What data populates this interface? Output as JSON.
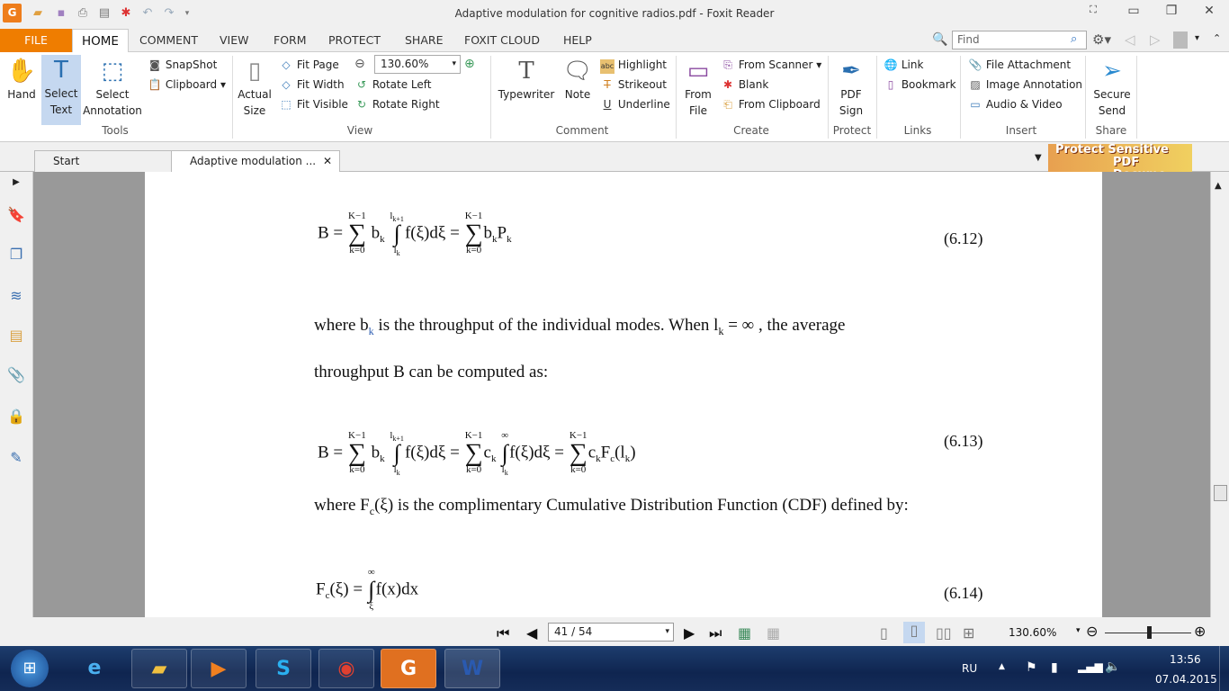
{
  "window": {
    "title": "Adaptive modulation for cognitive radios.pdf - Foxit Reader"
  },
  "quick_access": [
    "open-icon",
    "save-icon",
    "print-icon",
    "properties-icon",
    "new-icon",
    "undo-icon",
    "redo-icon",
    "customize-icon"
  ],
  "menu": {
    "file": "FILE",
    "tabs": [
      "HOME",
      "COMMENT",
      "VIEW",
      "FORM",
      "PROTECT",
      "SHARE",
      "FOXIT CLOUD",
      "HELP"
    ]
  },
  "search": {
    "placeholder": "Find"
  },
  "ribbon": {
    "tools": {
      "hand": "Hand",
      "select_text": "Select\nText",
      "select_annotation": "Select\nAnnotation",
      "snapshot": "SnapShot",
      "clipboard": "Clipboard",
      "group": "Tools"
    },
    "view": {
      "actual_size": "Actual\nSize",
      "fit_page": "Fit Page",
      "fit_width": "Fit Width",
      "fit_visible": "Fit Visible",
      "zoom": "130.60%",
      "rotate_left": "Rotate Left",
      "rotate_right": "Rotate Right",
      "group": "View"
    },
    "comment": {
      "typewriter": "Typewriter",
      "note": "Note",
      "highlight": "Highlight",
      "strikeout": "Strikeout",
      "underline": "Underline",
      "group": "Comment"
    },
    "create": {
      "from_file": "From\nFile",
      "from_scanner": "From Scanner",
      "blank": "Blank",
      "from_clipboard": "From Clipboard",
      "group": "Create"
    },
    "protect": {
      "pdf_sign": "PDF\nSign",
      "group": "Protect"
    },
    "links": {
      "link": "Link",
      "bookmark": "Bookmark",
      "group": "Links"
    },
    "insert": {
      "file_attachment": "File Attachment",
      "image_annotation": "Image Annotation",
      "audio_video": "Audio & Video",
      "group": "Insert"
    },
    "share": {
      "secure_send": "Secure\nSend",
      "group": "Share"
    }
  },
  "doc_tabs": [
    {
      "label": "Start"
    },
    {
      "label": "Adaptive modulation ..."
    }
  ],
  "ad": {
    "line1": "Protect Sensitive",
    "line2": "PDF Docume"
  },
  "document": {
    "eq612": {
      "lhs": "B = ",
      "sum1": "∑",
      "sum1_top": "K−1",
      "sum1_bot": "k=0",
      "b": "b",
      "bk": "k",
      "int": "∫",
      "int_top": "l",
      "int_top_sub": "k+1",
      "int_bot": "l",
      "int_bot_sub": "k",
      "f": "f(ξ)dξ = ",
      "sum2": "∑",
      "rest": "b",
      "rest_sub": "k",
      "p": "P",
      "p_sub": "k",
      "number": "(6.12)"
    },
    "line1": {
      "a": "where  b",
      "a_sub": "k",
      "b": "  is the throughput of the individual modes. When l",
      "b_sub": "k",
      "c": " = ∞ , the average"
    },
    "line2": "throughput B can be computed as:",
    "eq613": {
      "text1": "B = ",
      "s": "∑",
      "top": "K−1",
      "bot": "k=0",
      "t1": "b",
      "t1s": "k",
      "i1": "∫",
      "i1t": "l",
      "i1ts": "k+1",
      "i1b": "l",
      "i1bs": "k",
      "m1": "f(ξ)dξ = ",
      "c": "c",
      "cs": "k",
      "i2t": "∞",
      "m2": "f(ξ)dξ = ",
      "F": "F",
      "Fs": "c",
      "Fa": "(l",
      "Fas": "k",
      "Fb": ")",
      "number": "(6.13)"
    },
    "line3": {
      "a": "where  F",
      "a_sub": "c",
      "b": "(ξ) is the complimentary Cumulative Distribution Function (CDF) defined by:"
    },
    "eq614": {
      "F": "F",
      "Fs": "c",
      "a": "(ξ) = ",
      "int": "∫",
      "top": "∞",
      "bot": "ξ",
      "b": "f(x)dx",
      "number": "(6.14)"
    }
  },
  "status": {
    "page": "41 / 54",
    "zoom": "130.60%"
  },
  "taskbar": {
    "apps": [
      "windows-start",
      "internet-explorer",
      "file-explorer",
      "media-player",
      "skype",
      "chrome",
      "foxit-reader",
      "word"
    ],
    "lang": "RU",
    "time": "13:56",
    "date": "07.04.2015"
  }
}
